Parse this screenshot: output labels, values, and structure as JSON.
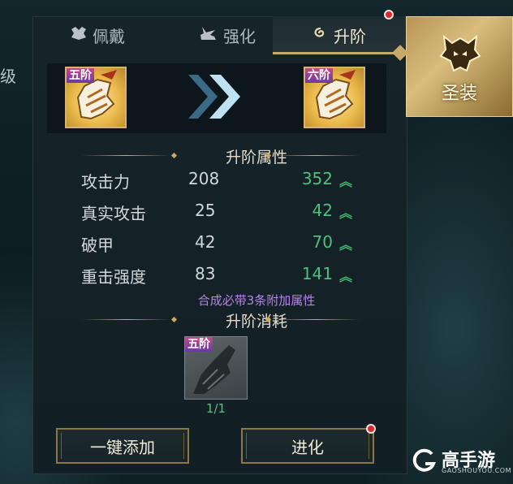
{
  "left_edge_text": "级",
  "tabs": [
    {
      "label": "佩戴",
      "icon": "gem-icon"
    },
    {
      "label": "强化",
      "icon": "anvil-icon"
    },
    {
      "label": "升阶",
      "icon": "swirl-icon",
      "active": true
    }
  ],
  "side_tab": {
    "label": "圣装",
    "icon": "helmet-icon"
  },
  "upgrade": {
    "from_badge": "五阶",
    "to_badge": "六阶",
    "arrow_icon": "double-chevron-right-icon"
  },
  "attributes": {
    "title": "升阶属性",
    "rows": [
      {
        "name": "攻击力",
        "old": "208",
        "new": "352"
      },
      {
        "name": "真实攻击",
        "old": "25",
        "new": "42"
      },
      {
        "name": "破甲",
        "old": "42",
        "new": "70"
      },
      {
        "name": "重击强度",
        "old": "83",
        "new": "141"
      }
    ]
  },
  "note": "合成必带3条附加属性",
  "cost": {
    "title": "升阶消耗",
    "badge": "五阶",
    "count": "1/1"
  },
  "buttons": {
    "auto_add": "一键添加",
    "evolve": "进化"
  },
  "watermark": {
    "brand": "高手游",
    "url": "GAOSHOUYOU.COM"
  },
  "colors": {
    "accent_gold": "#c9a968",
    "increase_green": "#4ec07c",
    "note_purple": "#b685e6",
    "notification_red": "#e0262a"
  }
}
